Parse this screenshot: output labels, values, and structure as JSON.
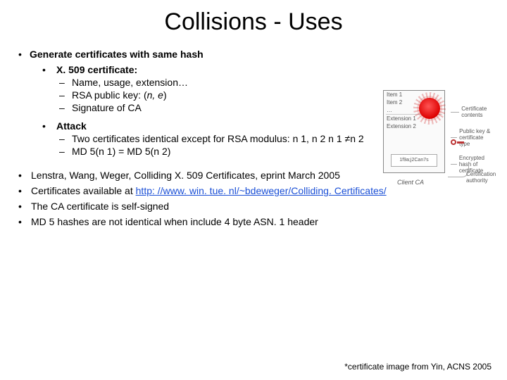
{
  "title": "Collisions - Uses",
  "b0": "Generate certificates with same hash",
  "s1": {
    "head": "X. 509 certificate:",
    "d1": "Name, usage, extension…",
    "d2_a": "RSA public key: (",
    "d2_b": "n, e",
    "d2_c": ")",
    "d3": "Signature of CA"
  },
  "s2": {
    "head": "Attack",
    "d1": "Two certificates identical except for RSA modulus: n 1, n 2 n 1 ≠n 2",
    "d2": "MD 5(n 1) = MD 5(n 2)"
  },
  "t": {
    "b1": "Lenstra, Wang, Weger, Colliding X. 509 Certificates, eprint March 2005",
    "b2a": "Certificates available at ",
    "b2link": "http: //www. win. tue. nl/~bdeweger/Colliding. Certificates/",
    "b3": "The CA certificate is self-signed",
    "b4": "MD 5 hashes are not identical when include 4 byte ASN. 1 header"
  },
  "footnote": "*certificate image from Yin, ACNS 2005",
  "diag": {
    "l1": "Item 1",
    "l2": "Item 2",
    "l3": "…",
    "l4": "Extension 1",
    "l5": "Extension 2",
    "hash": "1f9a;j2Can7s",
    "client": "Client CA",
    "lbl1": "Certificate contents",
    "lbl2": "Public key & certificate type",
    "lbl3": "Encrypted hash of certificate",
    "ca": "Certification authority"
  }
}
